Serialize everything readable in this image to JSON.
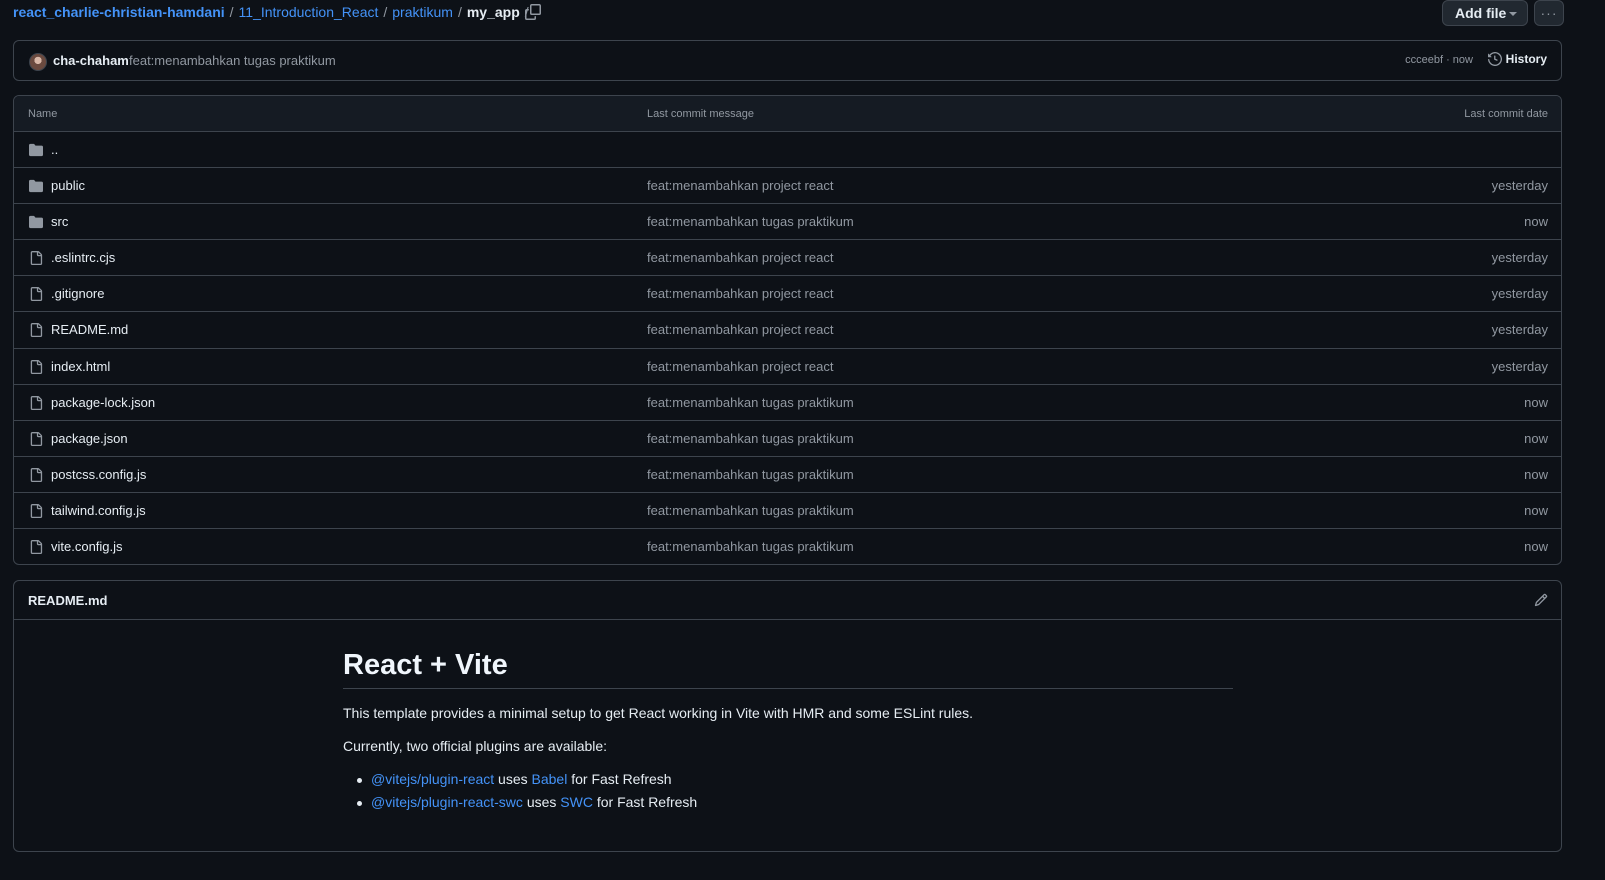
{
  "breadcrumb": {
    "owner": "react_charlie-christian-hamdani",
    "parts": [
      "11_Introduction_React",
      "praktikum"
    ],
    "current": "my_app",
    "trailing_sep": "/"
  },
  "actions": {
    "add_file": "Add file",
    "more": "···"
  },
  "commit": {
    "author": "cha-chaham",
    "message": "feat:menambahkan tugas praktikum",
    "sha_time": "ccceebf · now",
    "history": "History"
  },
  "table": {
    "headers": {
      "name": "Name",
      "message": "Last commit message",
      "date": "Last commit date"
    },
    "parent": "..",
    "rows": [
      {
        "type": "folder",
        "name": "public",
        "message": "feat:menambahkan project react",
        "date": "yesterday"
      },
      {
        "type": "folder",
        "name": "src",
        "message": "feat:menambahkan tugas praktikum",
        "date": "now"
      },
      {
        "type": "file",
        "name": ".eslintrc.cjs",
        "message": "feat:menambahkan project react",
        "date": "yesterday"
      },
      {
        "type": "file",
        "name": ".gitignore",
        "message": "feat:menambahkan project react",
        "date": "yesterday"
      },
      {
        "type": "file",
        "name": "README.md",
        "message": "feat:menambahkan project react",
        "date": "yesterday"
      },
      {
        "type": "file",
        "name": "index.html",
        "message": "feat:menambahkan project react",
        "date": "yesterday"
      },
      {
        "type": "file",
        "name": "package-lock.json",
        "message": "feat:menambahkan tugas praktikum",
        "date": "now"
      },
      {
        "type": "file",
        "name": "package.json",
        "message": "feat:menambahkan tugas praktikum",
        "date": "now"
      },
      {
        "type": "file",
        "name": "postcss.config.js",
        "message": "feat:menambahkan tugas praktikum",
        "date": "now"
      },
      {
        "type": "file",
        "name": "tailwind.config.js",
        "message": "feat:menambahkan tugas praktikum",
        "date": "now"
      },
      {
        "type": "file",
        "name": "vite.config.js",
        "message": "feat:menambahkan tugas praktikum",
        "date": "now"
      }
    ]
  },
  "readme": {
    "title": "README.md",
    "heading": "React + Vite",
    "para1": "This template provides a minimal setup to get React working in Vite with HMR and some ESLint rules.",
    "para2": "Currently, two official plugins are available:",
    "items": [
      {
        "plugin": "@vitejs/plugin-react",
        "uses": "uses",
        "tool": "Babel",
        "tail": "for Fast Refresh"
      },
      {
        "plugin": "@vitejs/plugin-react-swc",
        "uses": "uses",
        "tool": "SWC",
        "tail": "for Fast Refresh"
      }
    ]
  },
  "colors": {
    "background": "#0d1117",
    "border": "#3d444d",
    "link": "#4493f8",
    "muted": "#9198a1",
    "text": "#e6edf3"
  },
  "icons": [
    "copy-icon",
    "caret-down-icon",
    "kebab-icon",
    "avatar",
    "history-icon",
    "folder-icon",
    "file-icon",
    "pencil-icon"
  ]
}
